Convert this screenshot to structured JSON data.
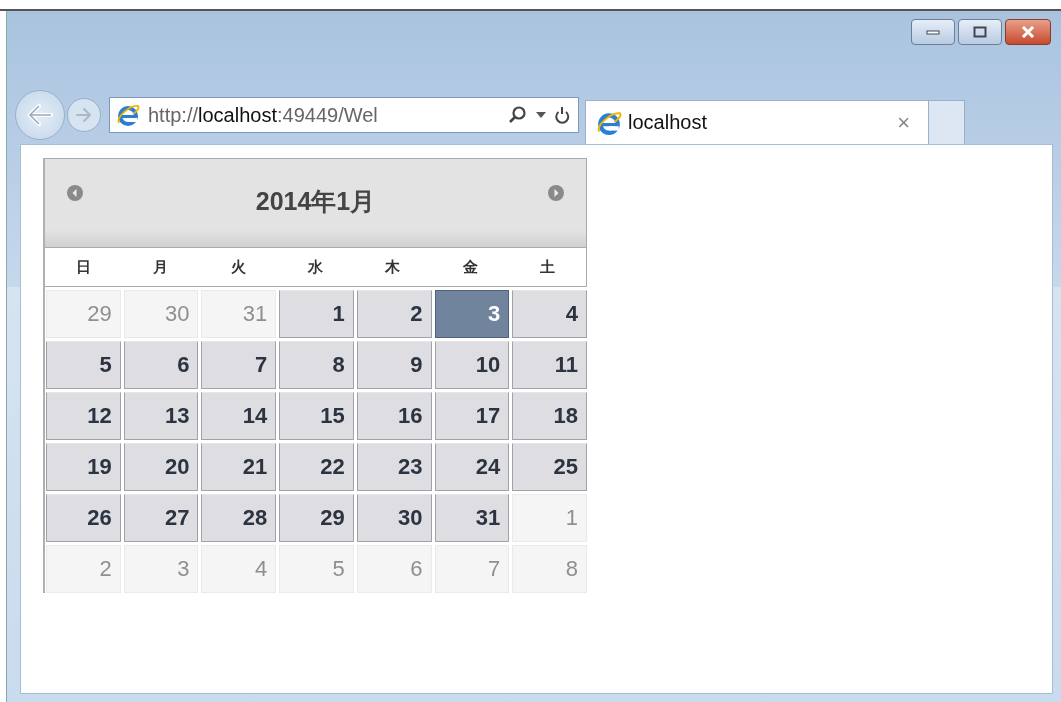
{
  "address_bar": {
    "url_prefix": "http://",
    "url_host": "localhost",
    "url_rest": ":49449/Wel"
  },
  "tab": {
    "title": "localhost",
    "close": "×",
    "selected": true
  },
  "calendar": {
    "title": "2014年1月",
    "weekdays": [
      "日",
      "月",
      "火",
      "水",
      "木",
      "金",
      "土"
    ],
    "weeks": [
      [
        {
          "day": "29",
          "other_month": true,
          "selected": false
        },
        {
          "day": "30",
          "other_month": true,
          "selected": false
        },
        {
          "day": "31",
          "other_month": true,
          "selected": false
        },
        {
          "day": "1",
          "other_month": false,
          "selected": false
        },
        {
          "day": "2",
          "other_month": false,
          "selected": false
        },
        {
          "day": "3",
          "other_month": false,
          "selected": true
        },
        {
          "day": "4",
          "other_month": false,
          "selected": false
        }
      ],
      [
        {
          "day": "5",
          "other_month": false,
          "selected": false
        },
        {
          "day": "6",
          "other_month": false,
          "selected": false
        },
        {
          "day": "7",
          "other_month": false,
          "selected": false
        },
        {
          "day": "8",
          "other_month": false,
          "selected": false
        },
        {
          "day": "9",
          "other_month": false,
          "selected": false
        },
        {
          "day": "10",
          "other_month": false,
          "selected": false
        },
        {
          "day": "11",
          "other_month": false,
          "selected": false
        }
      ],
      [
        {
          "day": "12",
          "other_month": false,
          "selected": false
        },
        {
          "day": "13",
          "other_month": false,
          "selected": false
        },
        {
          "day": "14",
          "other_month": false,
          "selected": false
        },
        {
          "day": "15",
          "other_month": false,
          "selected": false
        },
        {
          "day": "16",
          "other_month": false,
          "selected": false
        },
        {
          "day": "17",
          "other_month": false,
          "selected": false
        },
        {
          "day": "18",
          "other_month": false,
          "selected": false
        }
      ],
      [
        {
          "day": "19",
          "other_month": false,
          "selected": false
        },
        {
          "day": "20",
          "other_month": false,
          "selected": false
        },
        {
          "day": "21",
          "other_month": false,
          "selected": false
        },
        {
          "day": "22",
          "other_month": false,
          "selected": false
        },
        {
          "day": "23",
          "other_month": false,
          "selected": false
        },
        {
          "day": "24",
          "other_month": false,
          "selected": false
        },
        {
          "day": "25",
          "other_month": false,
          "selected": false
        }
      ],
      [
        {
          "day": "26",
          "other_month": false,
          "selected": false
        },
        {
          "day": "27",
          "other_month": false,
          "selected": false
        },
        {
          "day": "28",
          "other_month": false,
          "selected": false
        },
        {
          "day": "29",
          "other_month": false,
          "selected": false
        },
        {
          "day": "30",
          "other_month": false,
          "selected": false
        },
        {
          "day": "31",
          "other_month": false,
          "selected": false
        },
        {
          "day": "1",
          "other_month": true,
          "selected": false
        }
      ],
      [
        {
          "day": "2",
          "other_month": true,
          "selected": false
        },
        {
          "day": "3",
          "other_month": true,
          "selected": false
        },
        {
          "day": "4",
          "other_month": true,
          "selected": false
        },
        {
          "day": "5",
          "other_month": true,
          "selected": false
        },
        {
          "day": "6",
          "other_month": true,
          "selected": false
        },
        {
          "day": "7",
          "other_month": true,
          "selected": false
        },
        {
          "day": "8",
          "other_month": true,
          "selected": false
        }
      ]
    ]
  }
}
